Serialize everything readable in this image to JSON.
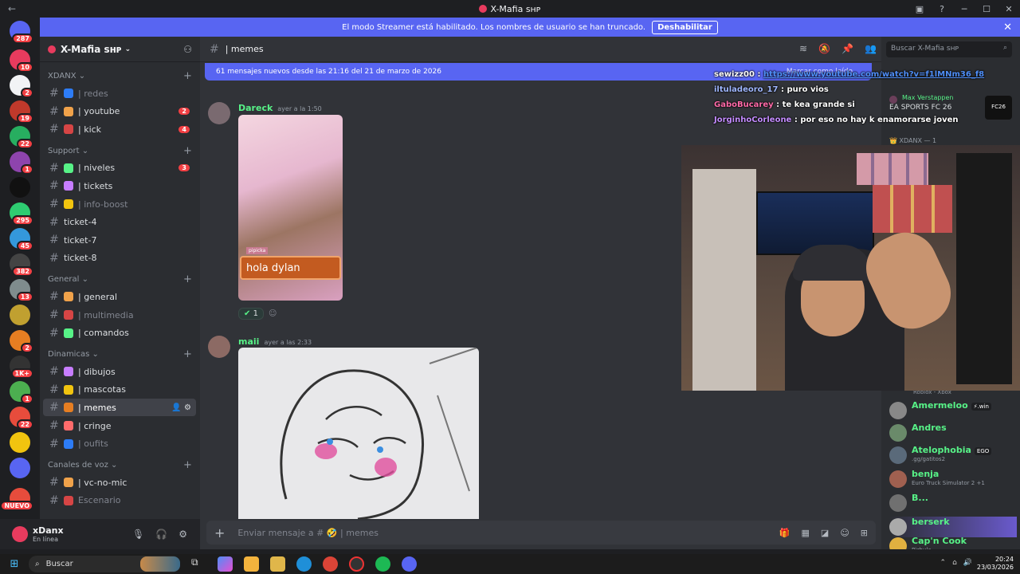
{
  "window": {
    "title": "X-Mafia ꜱʜᴘ",
    "nav_back": "←",
    "nav_fwd": "→"
  },
  "streamer_banner": {
    "text": "El modo Streamer está habilitado. Los nombres de usuario se han truncado.",
    "button": "Deshabilitar",
    "close": "✕"
  },
  "server": {
    "name": "X-Mafia ꜱʜᴘ"
  },
  "rail_badges": [
    "287",
    "10",
    "2",
    "19",
    "22",
    "1",
    "295",
    "45",
    "382",
    "13",
    "2",
    "1K+",
    "1",
    "22",
    "NUEVO"
  ],
  "categories": [
    {
      "name": "XDANX",
      "channels": [
        {
          "name": "| redes",
          "muted": true,
          "badge": ""
        },
        {
          "name": "| youtube",
          "muted": false,
          "badge": "2"
        },
        {
          "name": "| kick",
          "muted": false,
          "badge": "4"
        }
      ]
    },
    {
      "name": "Support",
      "channels": [
        {
          "name": "| niveles",
          "muted": false,
          "badge": "3"
        },
        {
          "name": "| tickets",
          "muted": false,
          "badge": ""
        },
        {
          "name": "| info-boost",
          "muted": true,
          "badge": ""
        },
        {
          "name": "ticket-4",
          "muted": false,
          "badge": ""
        },
        {
          "name": "ticket-7",
          "muted": false,
          "badge": ""
        },
        {
          "name": "ticket-8",
          "muted": false,
          "badge": ""
        }
      ]
    },
    {
      "name": "General",
      "channels": [
        {
          "name": "| general",
          "muted": false,
          "badge": ""
        },
        {
          "name": "| multimedia",
          "muted": true,
          "badge": ""
        },
        {
          "name": "| comandos",
          "muted": false,
          "badge": ""
        }
      ]
    },
    {
      "name": "Dinamicas",
      "channels": [
        {
          "name": "| dibujos",
          "muted": false,
          "badge": ""
        },
        {
          "name": "| mascotas",
          "muted": false,
          "badge": ""
        },
        {
          "name": "| memes",
          "muted": false,
          "badge": "",
          "active": true
        },
        {
          "name": "| cringe",
          "muted": false,
          "badge": ""
        },
        {
          "name": "| oufits",
          "muted": true,
          "badge": ""
        }
      ]
    },
    {
      "name": "Canales de voz",
      "channels": [
        {
          "name": "| vc-no-mic",
          "muted": false,
          "badge": ""
        },
        {
          "name": "Escenario",
          "muted": true,
          "badge": ""
        }
      ]
    }
  ],
  "user": {
    "name": "xDanx",
    "status": "En línea"
  },
  "channel_header": {
    "name": "| memes"
  },
  "new_messages": {
    "text": "61 mensajes nuevos desde las 21:16 del 21 de marzo de 2026",
    "mark_read": "Marcar como leído"
  },
  "messages": [
    {
      "author": "Dareck",
      "time": "ayer a la 1:50",
      "image_caption": "hola dylan",
      "image_tag": "pipicka",
      "reaction_count": "1"
    },
    {
      "author": "maii",
      "time": "ayer a las 2:33"
    }
  ],
  "composer": {
    "placeholder": "Enviar mensaje a # 🤣 | memes"
  },
  "member_search": {
    "placeholder": "Buscar X-Mafia ꜱʜᴘ"
  },
  "members_top": [
    {
      "name": "Max Verstappen",
      "sub": "EA SPORTS FC 26"
    }
  ],
  "member_group": "XDANX — 1",
  "members": [
    {
      "name": "Amermeloo",
      "sub": "",
      "tag": "⚡.win",
      "color": "#57f287"
    },
    {
      "name": "Andres",
      "sub": "",
      "tag": "",
      "color": "#57f287"
    },
    {
      "name": "Atelophobia",
      "sub": ".gg/gatitos2",
      "tag": "EGO",
      "color": "#57f287"
    },
    {
      "name": "benja",
      "sub": "Euro Truck Simulator 2 +1",
      "tag": "",
      "color": "#57f287"
    },
    {
      "name": "B...",
      "sub": "",
      "tag": "",
      "color": "#57f287"
    },
    {
      "name": "berserk",
      "sub": "",
      "tag": "",
      "color": "#57f287"
    },
    {
      "name": "Cap'n Cook",
      "sub": "Pizhula",
      "tag": "",
      "color": "#57f287"
    }
  ],
  "member_sub_roblox": "Roblox - Xbox",
  "overlay_chat": [
    {
      "user": "sewizz00",
      "text": "https://www.youtube.com/watch?v=f1lMNm36_f8",
      "color": "#ffffff"
    },
    {
      "user": "iltuladeoro_17",
      "text": "puro vios",
      "color": "#9fb7ff"
    },
    {
      "user": "GaboBucarey",
      "text": "te kea grande si",
      "color": "#ff6aa8"
    },
    {
      "user": "JorginhoCorleone",
      "text": "por eso no hay k enamorarse joven",
      "color": "#c48cff"
    }
  ],
  "taskbar": {
    "search": "Buscar",
    "time": "20:24",
    "date": "23/03/2026"
  }
}
